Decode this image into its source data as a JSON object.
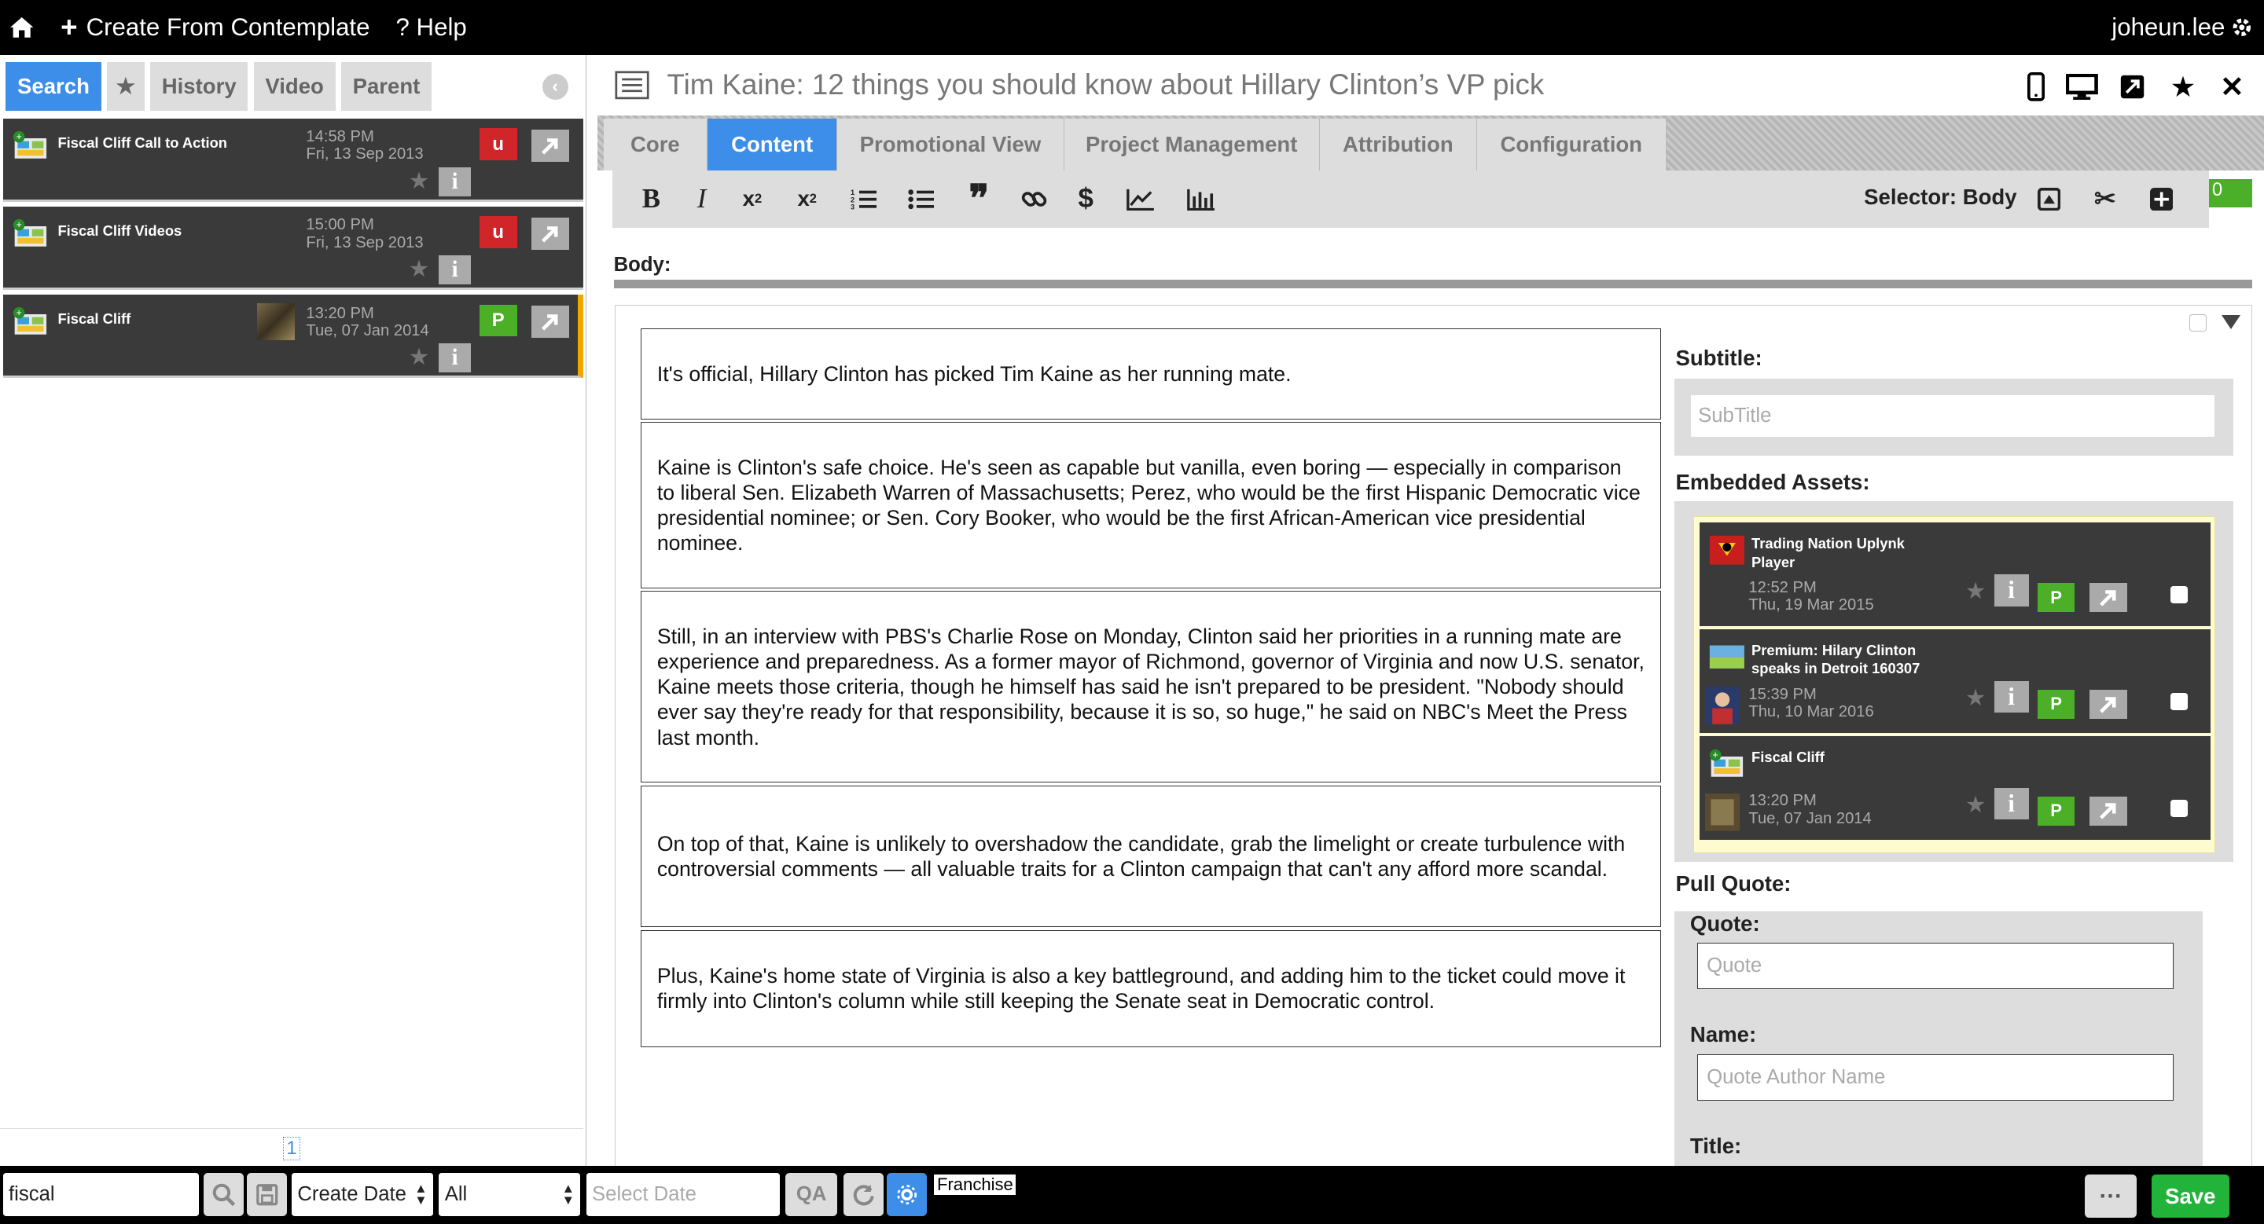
{
  "topbar": {
    "create_label": "Create From Contemplate",
    "help_label": "? Help",
    "username": "joheun.lee"
  },
  "left": {
    "tabs": [
      {
        "label": "Search"
      },
      {
        "label": "★"
      },
      {
        "label": "History"
      },
      {
        "label": "Video"
      },
      {
        "label": "Parent"
      }
    ],
    "results": [
      {
        "title": "Fiscal Cliff Call to Action",
        "time": "14:58 PM",
        "date": "Fri, 13 Sep 2013",
        "badge": "u"
      },
      {
        "title": "Fiscal Cliff Videos",
        "time": "15:00 PM",
        "date": "Fri, 13 Sep 2013",
        "badge": "u"
      },
      {
        "title": "Fiscal Cliff",
        "time": "13:20 PM",
        "date": "Tue, 07 Jan 2014",
        "badge": "P"
      }
    ],
    "page": "1"
  },
  "bottom": {
    "search_value": "fiscal",
    "sort_value": "Create Date",
    "filter_value": "All",
    "date_placeholder": "Select Date",
    "qa_label": "QA",
    "franchise_label": "Franchise",
    "more_label": "···",
    "save_label": "Save"
  },
  "main": {
    "title": "Tim Kaine: 12 things you should know about Hillary Clinton’s VP pick",
    "tabs": [
      {
        "label": "Core"
      },
      {
        "label": "Content"
      },
      {
        "label": "Promotional View"
      },
      {
        "label": "Project Management"
      },
      {
        "label": "Attribution"
      },
      {
        "label": "Configuration"
      }
    ],
    "toolbar": {
      "bold": "B",
      "italic": "I",
      "dollar": "$",
      "selector": "Selector: Body",
      "green_chip": "0"
    },
    "body_label": "Body:",
    "paragraphs": [
      "It's official, Hillary Clinton has picked Tim Kaine as her running mate.",
      "Kaine is Clinton's safe choice. He's seen as capable but vanilla, even boring — especially in comparison to liberal Sen. Elizabeth Warren of Massachusetts; Perez, who would be the first Hispanic Democratic vice presidential nominee; or Sen. Cory Booker, who would be the first African-American vice presidential nominee.",
      "Still, in an interview with PBS's Charlie Rose on Monday, Clinton said her priorities in a running mate are experience and preparedness. As a former mayor of Richmond, governor of Virginia and now U.S. senator, Kaine meets those criteria, though he himself has said he isn't prepared to be president. \"Nobody should ever say they're ready for that responsibility, because it is so, so huge,\" he said on NBC's Meet the Press last month.",
      "On top of that, Kaine is unlikely to overshadow the candidate, grab the limelight or create turbulence with controversial comments — all valuable traits for a Clinton campaign that can't any afford more scandal.",
      "Plus, Kaine's home state of Virginia is also a key battleground, and adding him to the ticket could move it firmly into Clinton's column while still keeping the Senate seat in Democratic control."
    ],
    "subtitle_label": "Subtitle:",
    "subtitle_placeholder": "SubTitle",
    "embedded_label": "Embedded Assets:",
    "assets": [
      {
        "name": "Trading Nation Uplynk Player",
        "time": "12:52 PM",
        "date": "Thu, 19 Mar 2015",
        "badge": "P"
      },
      {
        "name": "Premium: Hilary Clinton speaks in Detroit 160307",
        "time": "15:39 PM",
        "date": "Thu, 10 Mar 2016",
        "badge": "P"
      },
      {
        "name": "Fiscal Cliff",
        "time": "13:20 PM",
        "date": "Tue, 07 Jan 2014",
        "badge": "P"
      }
    ],
    "pull_quote_label": "Pull Quote:",
    "quote_label": "Quote:",
    "quote_placeholder": "Quote",
    "name_label": "Name:",
    "name_placeholder": "Quote Author Name",
    "title_label": "Title:"
  },
  "colors": {
    "accent": "#3d8ee8",
    "save": "#22b33a",
    "badge_u": "#d0262a",
    "badge_p": "#4caf28"
  }
}
